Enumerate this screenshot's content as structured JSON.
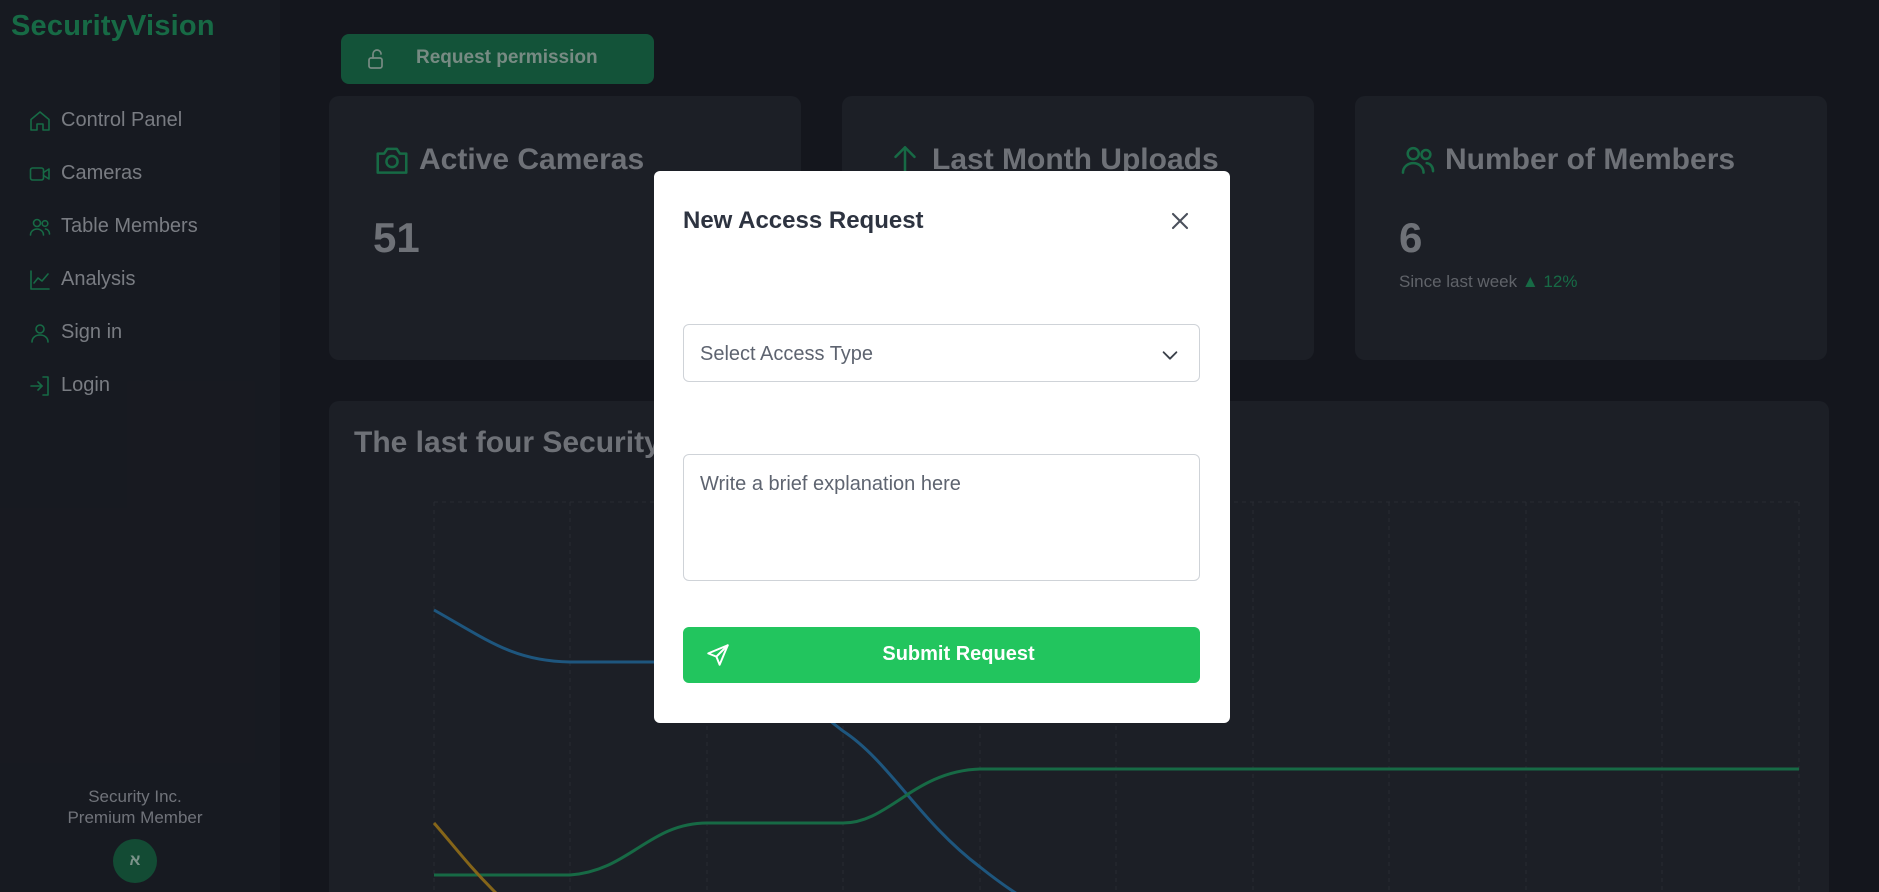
{
  "brand": "SecurityVision",
  "sidebar": {
    "items": [
      {
        "label": "Control Panel",
        "icon": "home-icon"
      },
      {
        "label": "Cameras",
        "icon": "video-icon"
      },
      {
        "label": "Table Members",
        "icon": "users-icon"
      },
      {
        "label": "Analysis",
        "icon": "chart-icon"
      },
      {
        "label": "Sign in",
        "icon": "user-icon"
      },
      {
        "label": "Login",
        "icon": "login-icon"
      }
    ],
    "footer_company": "Security Inc.",
    "footer_tier": "Premium Member",
    "avatar_initial": "א"
  },
  "toolbar": {
    "request_permission_label": "Request permission"
  },
  "cards": [
    {
      "title": "Active Cameras",
      "value": "51",
      "icon": "camera-icon"
    },
    {
      "title": "Last Month Uploads",
      "value": "",
      "icon": "upload-icon"
    },
    {
      "title": "Number of Members",
      "value": "6",
      "icon": "users-icon",
      "sub_label": "Since last week",
      "delta": "▲ 12%"
    }
  ],
  "chart": {
    "title": "The last four Security"
  },
  "modal": {
    "title": "New Access Request",
    "select_placeholder": "Select Access Type",
    "textarea_placeholder": "Write a brief explanation here",
    "submit_label": "Submit Request"
  },
  "colors": {
    "accent": "#22c55e",
    "brand": "#1f9d62",
    "series_blue": "#2a7fb8",
    "series_green": "#1f9d62",
    "series_yellow": "#c8961e"
  }
}
